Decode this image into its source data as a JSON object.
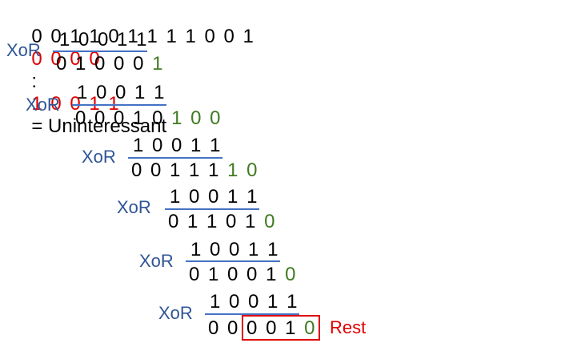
{
  "colors": {
    "black": "#000000",
    "red": "#e00000",
    "green": "#3f7a20",
    "blue": "#2f5597",
    "line": "#4472c4"
  },
  "header": {
    "dividend_black": "0 0 1 1 0 1 1 1 1 0 0 1",
    "dividend_red": "0 0 0 0",
    "colon": ":",
    "divisor": "1 0 0 1 1",
    "label": "= Uninteressant"
  },
  "steps": [
    {
      "xor": "XoR",
      "sub": "1 0 0 1 1",
      "result": "0 1 0 0 0",
      "down": "1"
    },
    {
      "xor": "XoR",
      "sub": "1 0 0 1 1",
      "result": "0 0 0 1 0",
      "down": "1 0 0"
    },
    {
      "xor": "XoR",
      "sub": "1 0 0 1 1",
      "result": "0 0 1 1 1",
      "down": "1 0"
    },
    {
      "xor": "XoR",
      "sub": "1 0 0 1 1",
      "result": "0 1 1 0 1",
      "down": "0"
    },
    {
      "xor": "XoR",
      "sub": "1 0 0 1 1",
      "result": "0 1 0 0 1",
      "down": "0"
    },
    {
      "xor": "XoR",
      "sub": "1 0 0 1 1",
      "result_lead": "0 0",
      "result_boxed": "0 0 1",
      "down": "0",
      "rest": "Rest"
    }
  ]
}
